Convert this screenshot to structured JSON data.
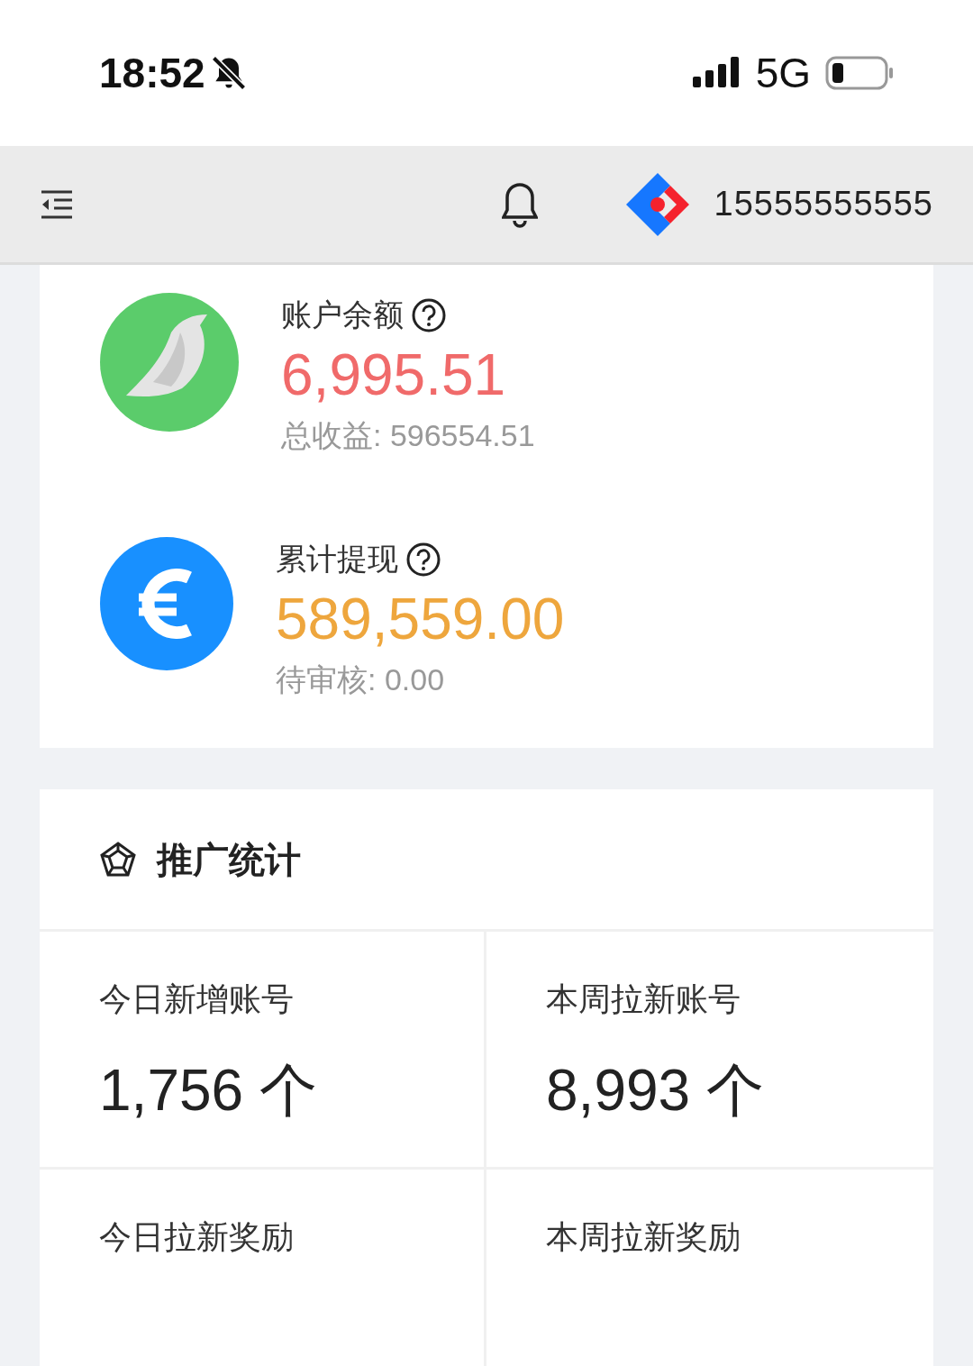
{
  "status_bar": {
    "time": "18:52",
    "muted": true,
    "network": "5G"
  },
  "header": {
    "account": "15555555555"
  },
  "balances": [
    {
      "kind": "bird",
      "label": "账户余额",
      "value": "6,995.51",
      "color": "#f06a6a",
      "sub": "总收益: 596554.51"
    },
    {
      "kind": "euro",
      "label": "累计提现",
      "value": "589,559.00",
      "color": "#eea63d",
      "sub": "待审核: 0.00"
    }
  ],
  "stats": {
    "title": "推广统计",
    "cells": [
      {
        "label": "今日新增账号",
        "value": "1,756 个"
      },
      {
        "label": "本周拉新账号",
        "value": "8,993 个"
      },
      {
        "label": "今日拉新奖励"
      },
      {
        "label": "本周拉新奖励"
      }
    ]
  }
}
